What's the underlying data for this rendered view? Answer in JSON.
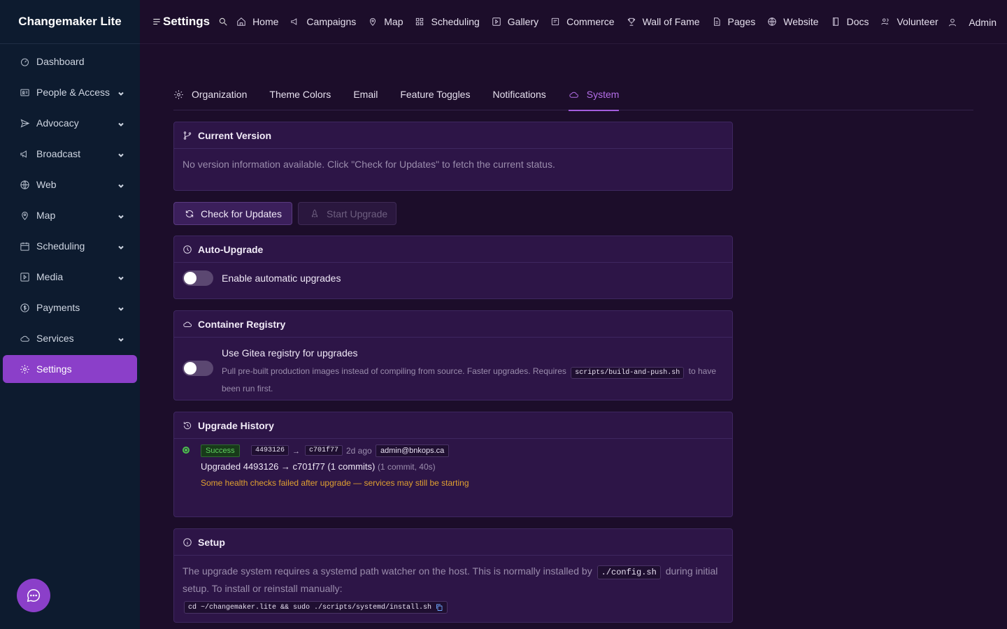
{
  "brand": "Changemaker Lite",
  "sidebar": {
    "items": [
      {
        "label": "Dashboard",
        "icon": "gauge-icon"
      },
      {
        "label": "People & Access",
        "icon": "id-card-icon"
      },
      {
        "label": "Advocacy",
        "icon": "send-icon"
      },
      {
        "label": "Broadcast",
        "icon": "megaphone-icon"
      },
      {
        "label": "Web",
        "icon": "globe-icon"
      },
      {
        "label": "Map",
        "icon": "map-pin-icon"
      },
      {
        "label": "Scheduling",
        "icon": "calendar-icon"
      },
      {
        "label": "Media",
        "icon": "play-square-icon"
      },
      {
        "label": "Payments",
        "icon": "dollar-circle-icon"
      },
      {
        "label": "Services",
        "icon": "cloud-icon"
      },
      {
        "label": "Settings",
        "icon": "gear-icon"
      }
    ]
  },
  "topbar": {
    "title": "Settings",
    "links": [
      {
        "label": "Home",
        "icon": "home-icon"
      },
      {
        "label": "Campaigns",
        "icon": "megaphone-icon"
      },
      {
        "label": "Map",
        "icon": "map-pin-icon"
      },
      {
        "label": "Scheduling",
        "icon": "grid-icon"
      },
      {
        "label": "Gallery",
        "icon": "play-square-icon"
      },
      {
        "label": "Commerce",
        "icon": "shop-icon"
      },
      {
        "label": "Wall of Fame",
        "icon": "trophy-icon"
      },
      {
        "label": "Pages",
        "icon": "file-icon"
      },
      {
        "label": "Website",
        "icon": "globe-icon"
      },
      {
        "label": "Docs",
        "icon": "book-icon"
      },
      {
        "label": "Volunteer",
        "icon": "users-icon"
      }
    ],
    "admin": "Admin"
  },
  "tabs": [
    {
      "label": "Organization"
    },
    {
      "label": "Theme Colors"
    },
    {
      "label": "Email"
    },
    {
      "label": "Feature Toggles"
    },
    {
      "label": "Notifications"
    },
    {
      "label": "System"
    }
  ],
  "current_version": {
    "title": "Current Version",
    "message": "No version information available. Click \"Check for Updates\" to fetch the current status."
  },
  "buttons": {
    "check": "Check for Updates",
    "upgrade": "Start Upgrade"
  },
  "auto_upgrade": {
    "title": "Auto-Upgrade",
    "toggle_label": "Enable automatic upgrades",
    "enabled": false
  },
  "registry": {
    "title": "Container Registry",
    "toggle_label": "Use Gitea registry for upgrades",
    "desc_before": "Pull pre-built production images instead of compiling from source. Faster upgrades. Requires",
    "desc_code": "scripts/build-and-push.sh",
    "desc_after": "to have",
    "desc_line2": "been run first.",
    "enabled": false
  },
  "history": {
    "title": "Upgrade History",
    "entry": {
      "status": "Success",
      "from": "4493126",
      "arrow": "→",
      "to": "c701f77",
      "ago": "2d ago",
      "user": "admin@bnkops.ca",
      "summary": "Upgraded 4493126 → c701f77 (1 commits)",
      "meta": "(1 commit, 40s)",
      "warning": "Some health checks failed after upgrade — services may still be starting"
    },
    "colors": {
      "success": "#4cc24c",
      "warning": "#e0a030"
    }
  },
  "setup": {
    "title": "Setup",
    "text_before": "The upgrade system requires a systemd path watcher on the host. This is normally installed by",
    "text_code": "./config.sh",
    "text_after": "during initial",
    "text_line2": "setup. To install or reinstall manually:",
    "command": "cd ~/changemaker.lite && sudo ./scripts/systemd/install.sh"
  },
  "colors": {
    "accent": "#8b3fc9",
    "sidebar_bg": "#0d1b2f",
    "page_bg": "#1c0d2a",
    "card_bg": "#2d1547"
  }
}
